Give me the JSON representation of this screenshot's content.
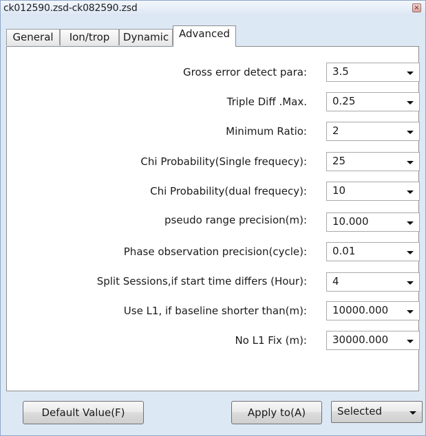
{
  "window": {
    "title": "ck012590.zsd-ck082590.zsd",
    "close_glyph": "×"
  },
  "tabs": [
    {
      "label": "General",
      "active": false
    },
    {
      "label": "Ion/trop",
      "active": false
    },
    {
      "label": "Dynamic",
      "active": false
    },
    {
      "label": "Advanced",
      "active": true
    }
  ],
  "settings": [
    {
      "label": "Gross error detect para:",
      "value": "3.5"
    },
    {
      "label": "Triple Diff .Max.",
      "value": "0.25"
    },
    {
      "label": "Minimum Ratio:",
      "value": "2"
    },
    {
      "label": "Chi Probability(Single frequecy):",
      "value": "25"
    },
    {
      "label": "Chi Probability(dual frequecy):",
      "value": "10"
    },
    {
      "label": "pseudo range precision(m):",
      "value": "10.000"
    },
    {
      "label": "Phase observation precision(cycle):",
      "value": "0.01"
    },
    {
      "label": "Split Sessions,if start time differs (Hour):",
      "value": "4"
    },
    {
      "label": "Use L1, if baseline shorter than(m):",
      "value": "10000.000"
    },
    {
      "label": "No L1 Fix (m):",
      "value": "30000.000"
    }
  ],
  "footer": {
    "default_button": "Default Value(F)",
    "apply_button": "Apply to(A)",
    "apply_target": "Selected"
  },
  "icons": {
    "dropdown": "chevron-down-icon",
    "close": "close-icon"
  },
  "colors": {
    "titlebar": "#dbe6f3",
    "frame": "#dde8f5",
    "panel": "#ffffff"
  }
}
